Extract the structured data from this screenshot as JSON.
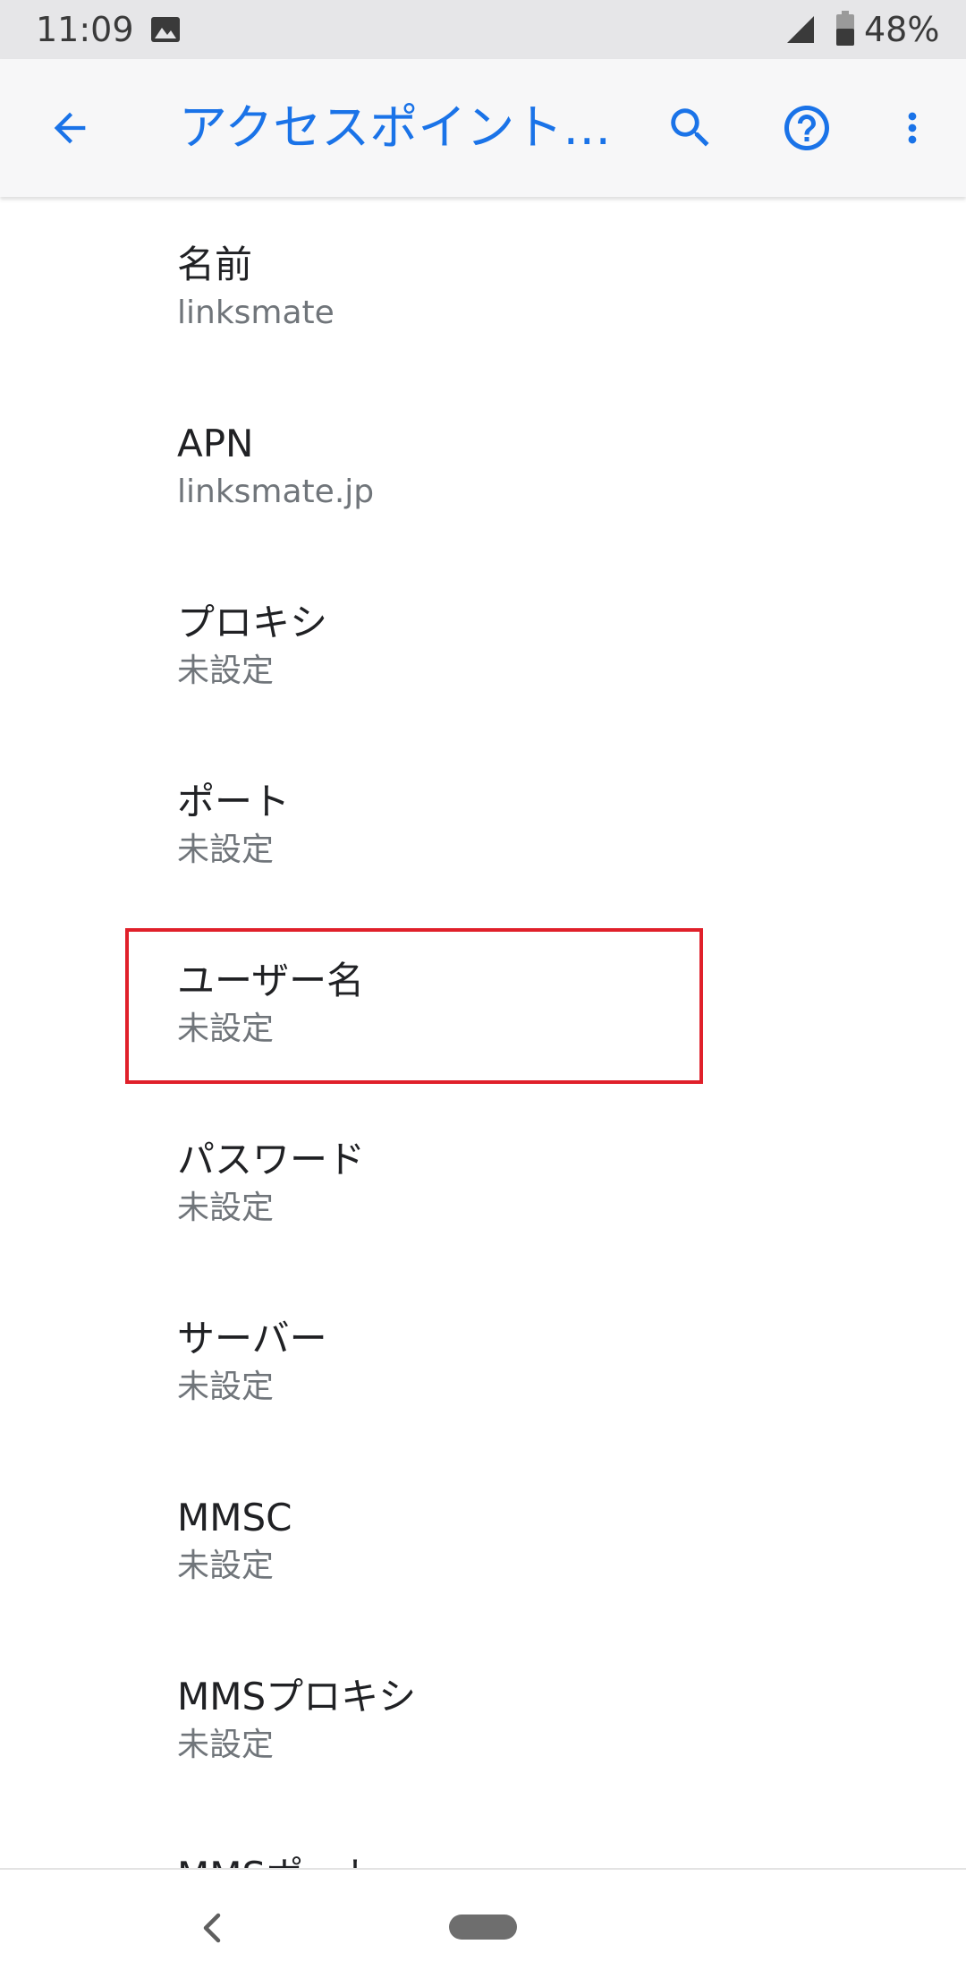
{
  "status_bar": {
    "time": "11:09",
    "battery": "48%"
  },
  "app_bar": {
    "title": "アクセスポイント…"
  },
  "colors": {
    "accent": "#1a73e8",
    "highlight": "#e0202a"
  },
  "icons": {
    "back": "arrow-back-icon",
    "search": "search-icon",
    "help": "help-icon",
    "more": "more-vert-icon"
  },
  "apn_settings": [
    {
      "title": "名前",
      "value": "linksmate"
    },
    {
      "title": "APN",
      "value": "linksmate.jp"
    },
    {
      "title": "プロキシ",
      "value": "未設定"
    },
    {
      "title": "ポート",
      "value": "未設定"
    },
    {
      "title": "ユーザー名",
      "value": "未設定"
    },
    {
      "title": "パスワード",
      "value": "未設定"
    },
    {
      "title": "サーバー",
      "value": "未設定"
    },
    {
      "title": "MMSC",
      "value": "未設定"
    },
    {
      "title": "MMSプロキシ",
      "value": "未設定"
    },
    {
      "title": "MMSポート",
      "value": ""
    }
  ]
}
